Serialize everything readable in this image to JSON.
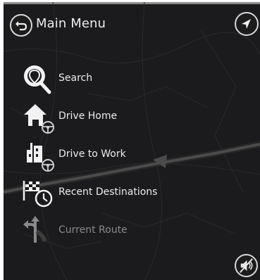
{
  "header": {
    "title": "Main Menu",
    "back_icon": "back-arrow-icon",
    "compass_icon": "navigation-arrow-icon"
  },
  "menu": {
    "items": [
      {
        "label": "Search",
        "icon": "magnifier-icon",
        "enabled": true
      },
      {
        "label": "Drive Home",
        "icon": "home-icon",
        "enabled": true
      },
      {
        "label": "Drive to Work",
        "icon": "work-building-icon",
        "enabled": true
      },
      {
        "label": "Recent Destinations",
        "icon": "recent-flag-clock-icon",
        "enabled": true
      },
      {
        "label": "Current Route",
        "icon": "route-fork-icon",
        "enabled": false
      }
    ]
  },
  "footer": {
    "mute_icon": "muted-speaker-icon"
  },
  "colors": {
    "background": "#1b1b1d",
    "text": "#ececec",
    "disabled_text": "#8a8a8a",
    "icon": "#e8e8e8"
  }
}
